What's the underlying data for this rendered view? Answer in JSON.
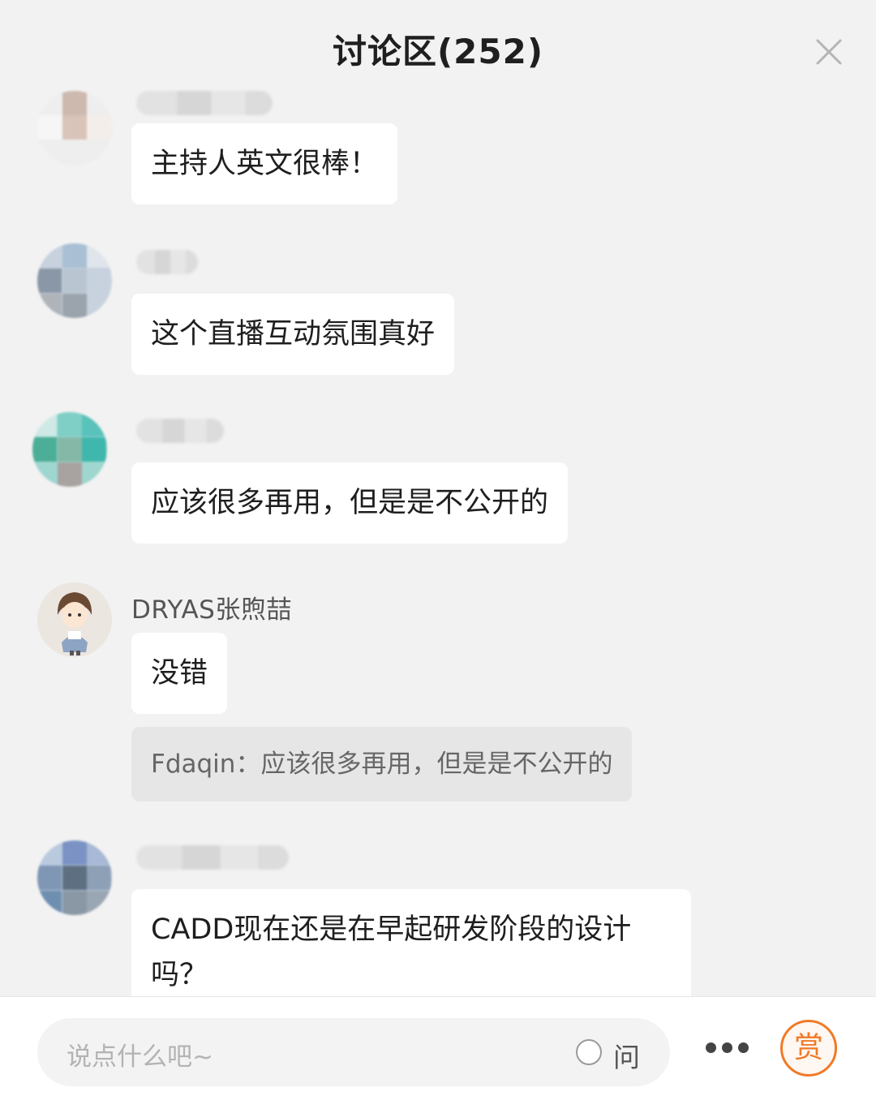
{
  "header": {
    "title": "讨论区(252)"
  },
  "messages": [
    {
      "text": "主持人英文很棒！"
    },
    {
      "text": "这个直播互动氛围真好"
    },
    {
      "text": "应该很多再用，但是是不公开的"
    },
    {
      "user": "DRYAS张煦喆",
      "text": "没错",
      "quote": "Fdaqin：应该很多再用，但是是不公开的"
    },
    {
      "text": "CADD现在还是在早起研发阶段的设计吗？"
    }
  ],
  "bottom": {
    "input_placeholder": "说点什么吧~",
    "ask_label": "问",
    "reward_label": "赏"
  },
  "colors": {
    "accent": "#f07a28",
    "bubble": "#ffffff",
    "quote": "#e6e6e6",
    "background": "#f2f2f2"
  },
  "icons": {
    "close": "close-icon",
    "more": "more-icon",
    "reward": "reward-icon"
  }
}
